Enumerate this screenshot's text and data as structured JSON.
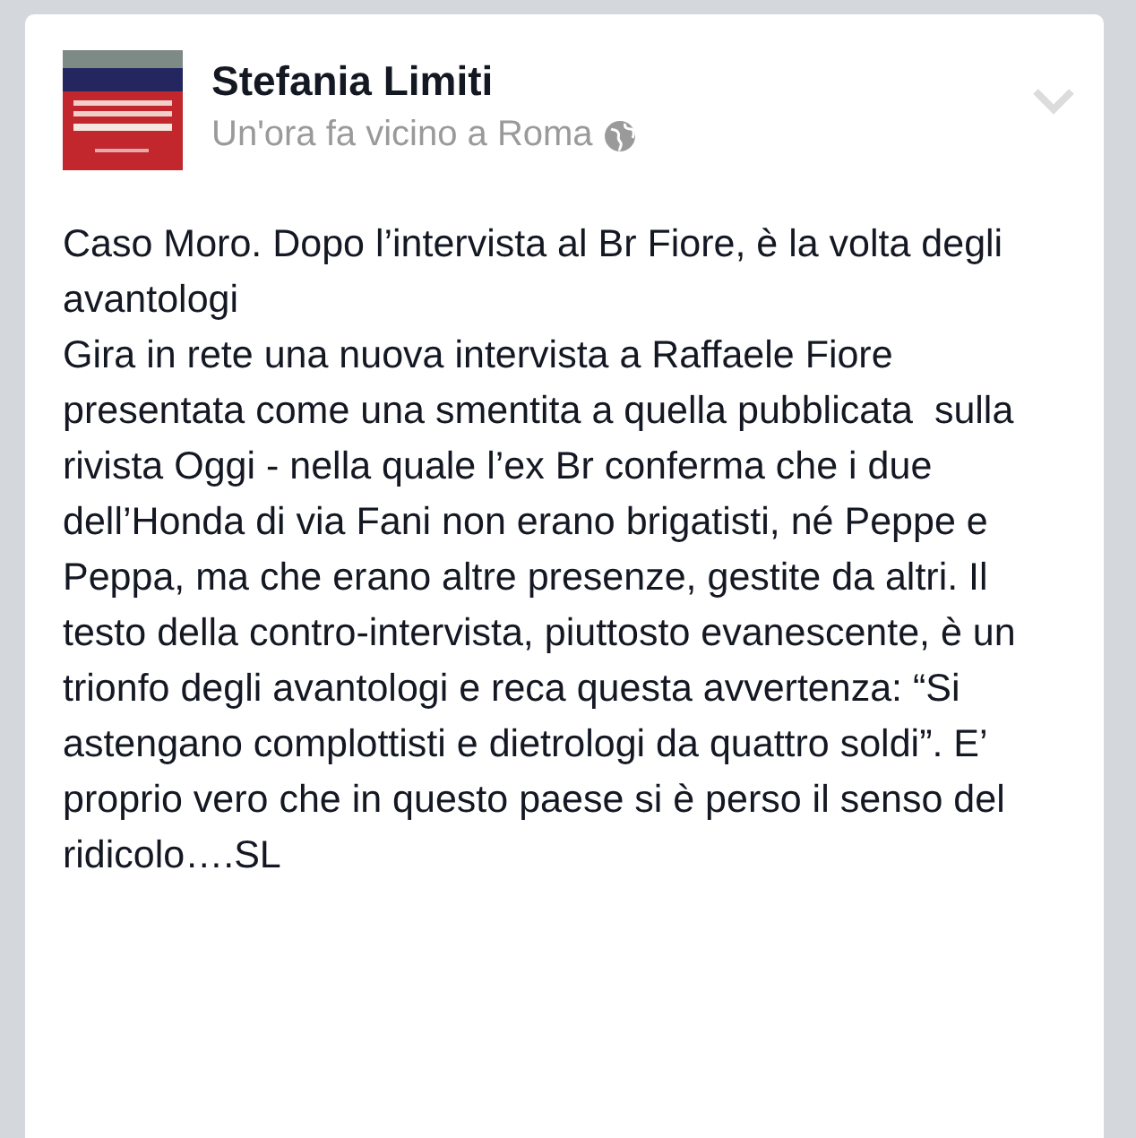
{
  "post": {
    "author": "Stefania Limiti",
    "meta": "Un'ora fa vicino a Roma",
    "paragraphs": [
      "Caso Moro. Dopo l’intervista al Br Fiore, è la volta degli avantologi",
      "Gira in rete una nuova intervista a Raffaele Fiore presentata come una smentita a quella pubblicata  sulla rivista Oggi - nella quale l’ex Br conferma che i due dell’Honda di via Fani non erano brigatisti, né Peppe e Peppa, ma che erano altre presenze, gestite da altri. Il testo della contro-intervista, piuttosto evanescente, è un trionfo degli avantologi e reca questa avvertenza: “Si astengano complottisti e dietrologi da quattro soldi”. E’ proprio vero che in questo paese si è perso il senso del ridicolo….SL"
    ]
  }
}
